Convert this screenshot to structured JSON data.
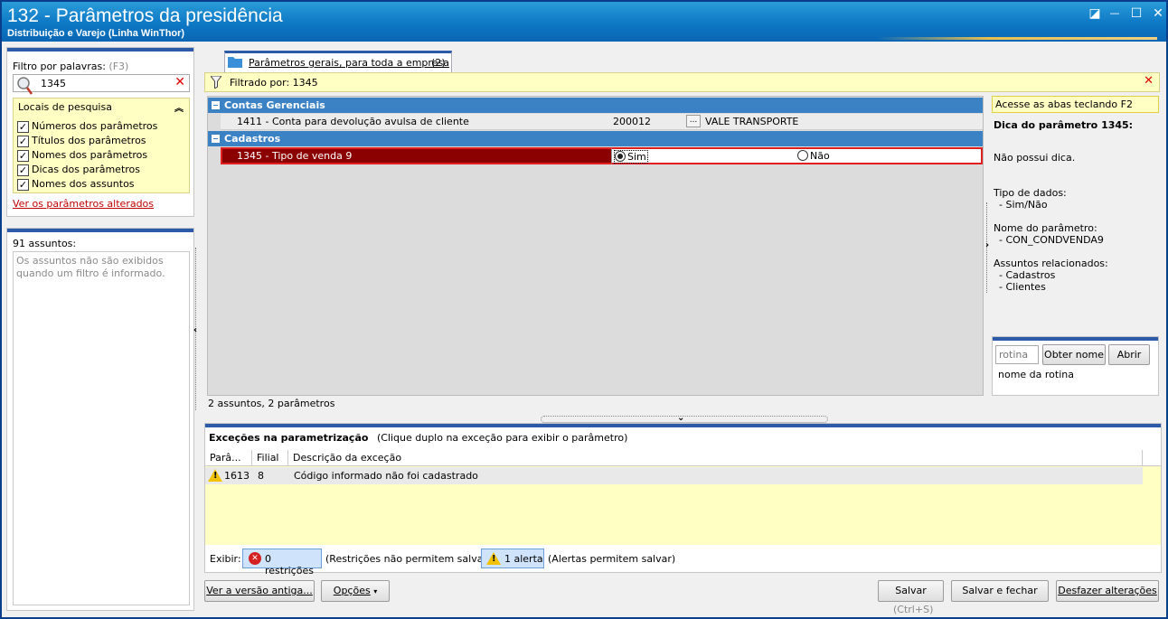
{
  "window": {
    "title": "132 - Parâmetros da presidência",
    "subtitle": "Distribuição e Varejo (Linha WinThor)",
    "controls": {
      "restore": "◪",
      "minimize": "—",
      "maximize": "☐",
      "close": "✕"
    }
  },
  "filter": {
    "label": "Filtro por palavras:",
    "shortcut": "(F3)",
    "value": "1345",
    "locations_title": "Locais de pesquisa",
    "locations": [
      {
        "label": "Números dos parâmetros",
        "checked": "✓"
      },
      {
        "label": "Títulos dos parâmetros",
        "checked": "✓"
      },
      {
        "label": "Nomes dos parâmetros",
        "checked": "✓"
      },
      {
        "label": "Dicas dos parâmetros",
        "checked": "✓"
      },
      {
        "label": "Nomes dos assuntos",
        "checked": "✓"
      }
    ],
    "changed_link": "Ver os parâmetros alterados"
  },
  "subjects": {
    "count_label": "91 assuntos:",
    "placeholder": "Os assuntos não são exibidos quando um filtro é informado."
  },
  "tab": {
    "label": "Parâmetros gerais, para toda a empresa",
    "count": "(2)"
  },
  "filtered_by": "Filtrado por: 1345",
  "groups": [
    {
      "title": "Contas Gerenciais",
      "row": {
        "label": "1411 - Conta para devolução avulsa de cliente",
        "value": "200012",
        "lookup": "...",
        "desc": "VALE TRANSPORTE"
      }
    },
    {
      "title": "Cadastros",
      "row": {
        "label": "1345 - Tipo de venda 9",
        "option_yes": "Sim",
        "option_no": "Não"
      }
    }
  ],
  "grid_status": "2 assuntos, 2 parâmetros",
  "hint": {
    "access": "Acesse as abas teclando F2",
    "title": "Dica do parâmetro 1345:",
    "no_hint": "Não possui dica.",
    "type_label": "Tipo de dados:",
    "type_value": "- Sim/Não",
    "name_label": "Nome do parâmetro:",
    "name_value": "- CON_CONDVENDA9",
    "related_label": "Assuntos relacionados:",
    "related": [
      "- Cadastros",
      "- Clientes"
    ]
  },
  "routine": {
    "placeholder": "rotina",
    "get_name": "Obter nome",
    "open": "Abrir",
    "name_label": "nome da rotina"
  },
  "exceptions": {
    "title": "Exceções na parametrização",
    "hint": "(Clique duplo na exceção para exibir o parâmetro)",
    "columns": [
      "Parâ...",
      "Filial",
      "Descrição da exceção"
    ],
    "rows": [
      {
        "param": "1613",
        "branch": "8",
        "desc": "Código informado não foi cadastrado"
      }
    ],
    "show_label": "Exibir:",
    "restrictions_btn": "0 restrições",
    "restrictions_note": "(Restrições não permitem salvar)",
    "alerts_btn": "1 alerta",
    "alerts_note": "(Alertas permitem salvar)"
  },
  "footer": {
    "old_version": "Ver a versão antiga...",
    "options": "Opções",
    "save": "Salvar",
    "save_shortcut": "(Ctrl+S)",
    "save_close": "Salvar e fechar",
    "undo": "Desfazer alterações"
  }
}
